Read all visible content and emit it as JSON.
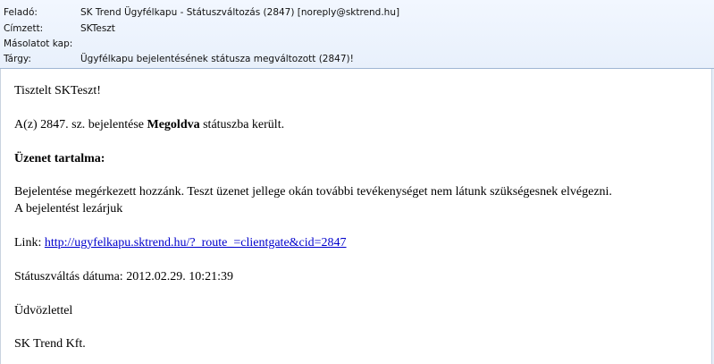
{
  "header": {
    "from_label": "Feladó:",
    "from_value": "SK Trend Ügyfélkapu - Státuszváltozás (2847) [noreply@sktrend.hu]",
    "to_label": "Címzett:",
    "to_value": "SKTeszt",
    "cc_label": "Másolatot kap:",
    "cc_value": "",
    "subject_label": "Tárgy:",
    "subject_value": "Ügyfélkapu bejelentésének státusza megváltozott (2847)!"
  },
  "body": {
    "greeting": "Tisztelt SKTeszt!",
    "status_prefix": "A(z) 2847. sz. bejelentése ",
    "status_word": "Megoldva",
    "status_suffix": " státuszba került.",
    "message_heading": "Üzenet tartalma:",
    "message_line1": "Bejelentése megérkezett hozzánk. Teszt üzenet jellege okán további tevékenységet nem látunk szükségesnek elvégezni.",
    "message_line2": "A bejelentést lezárjuk",
    "link_label": "Link: ",
    "link_url": "http://ugyfelkapu.sktrend.hu/?_route_=clientgate&cid=2847",
    "date_line": "Státuszváltás dátuma: 2012.02.29. 10:21:39",
    "closing": "Üdvözlettel",
    "signature": "SK Trend Kft."
  }
}
